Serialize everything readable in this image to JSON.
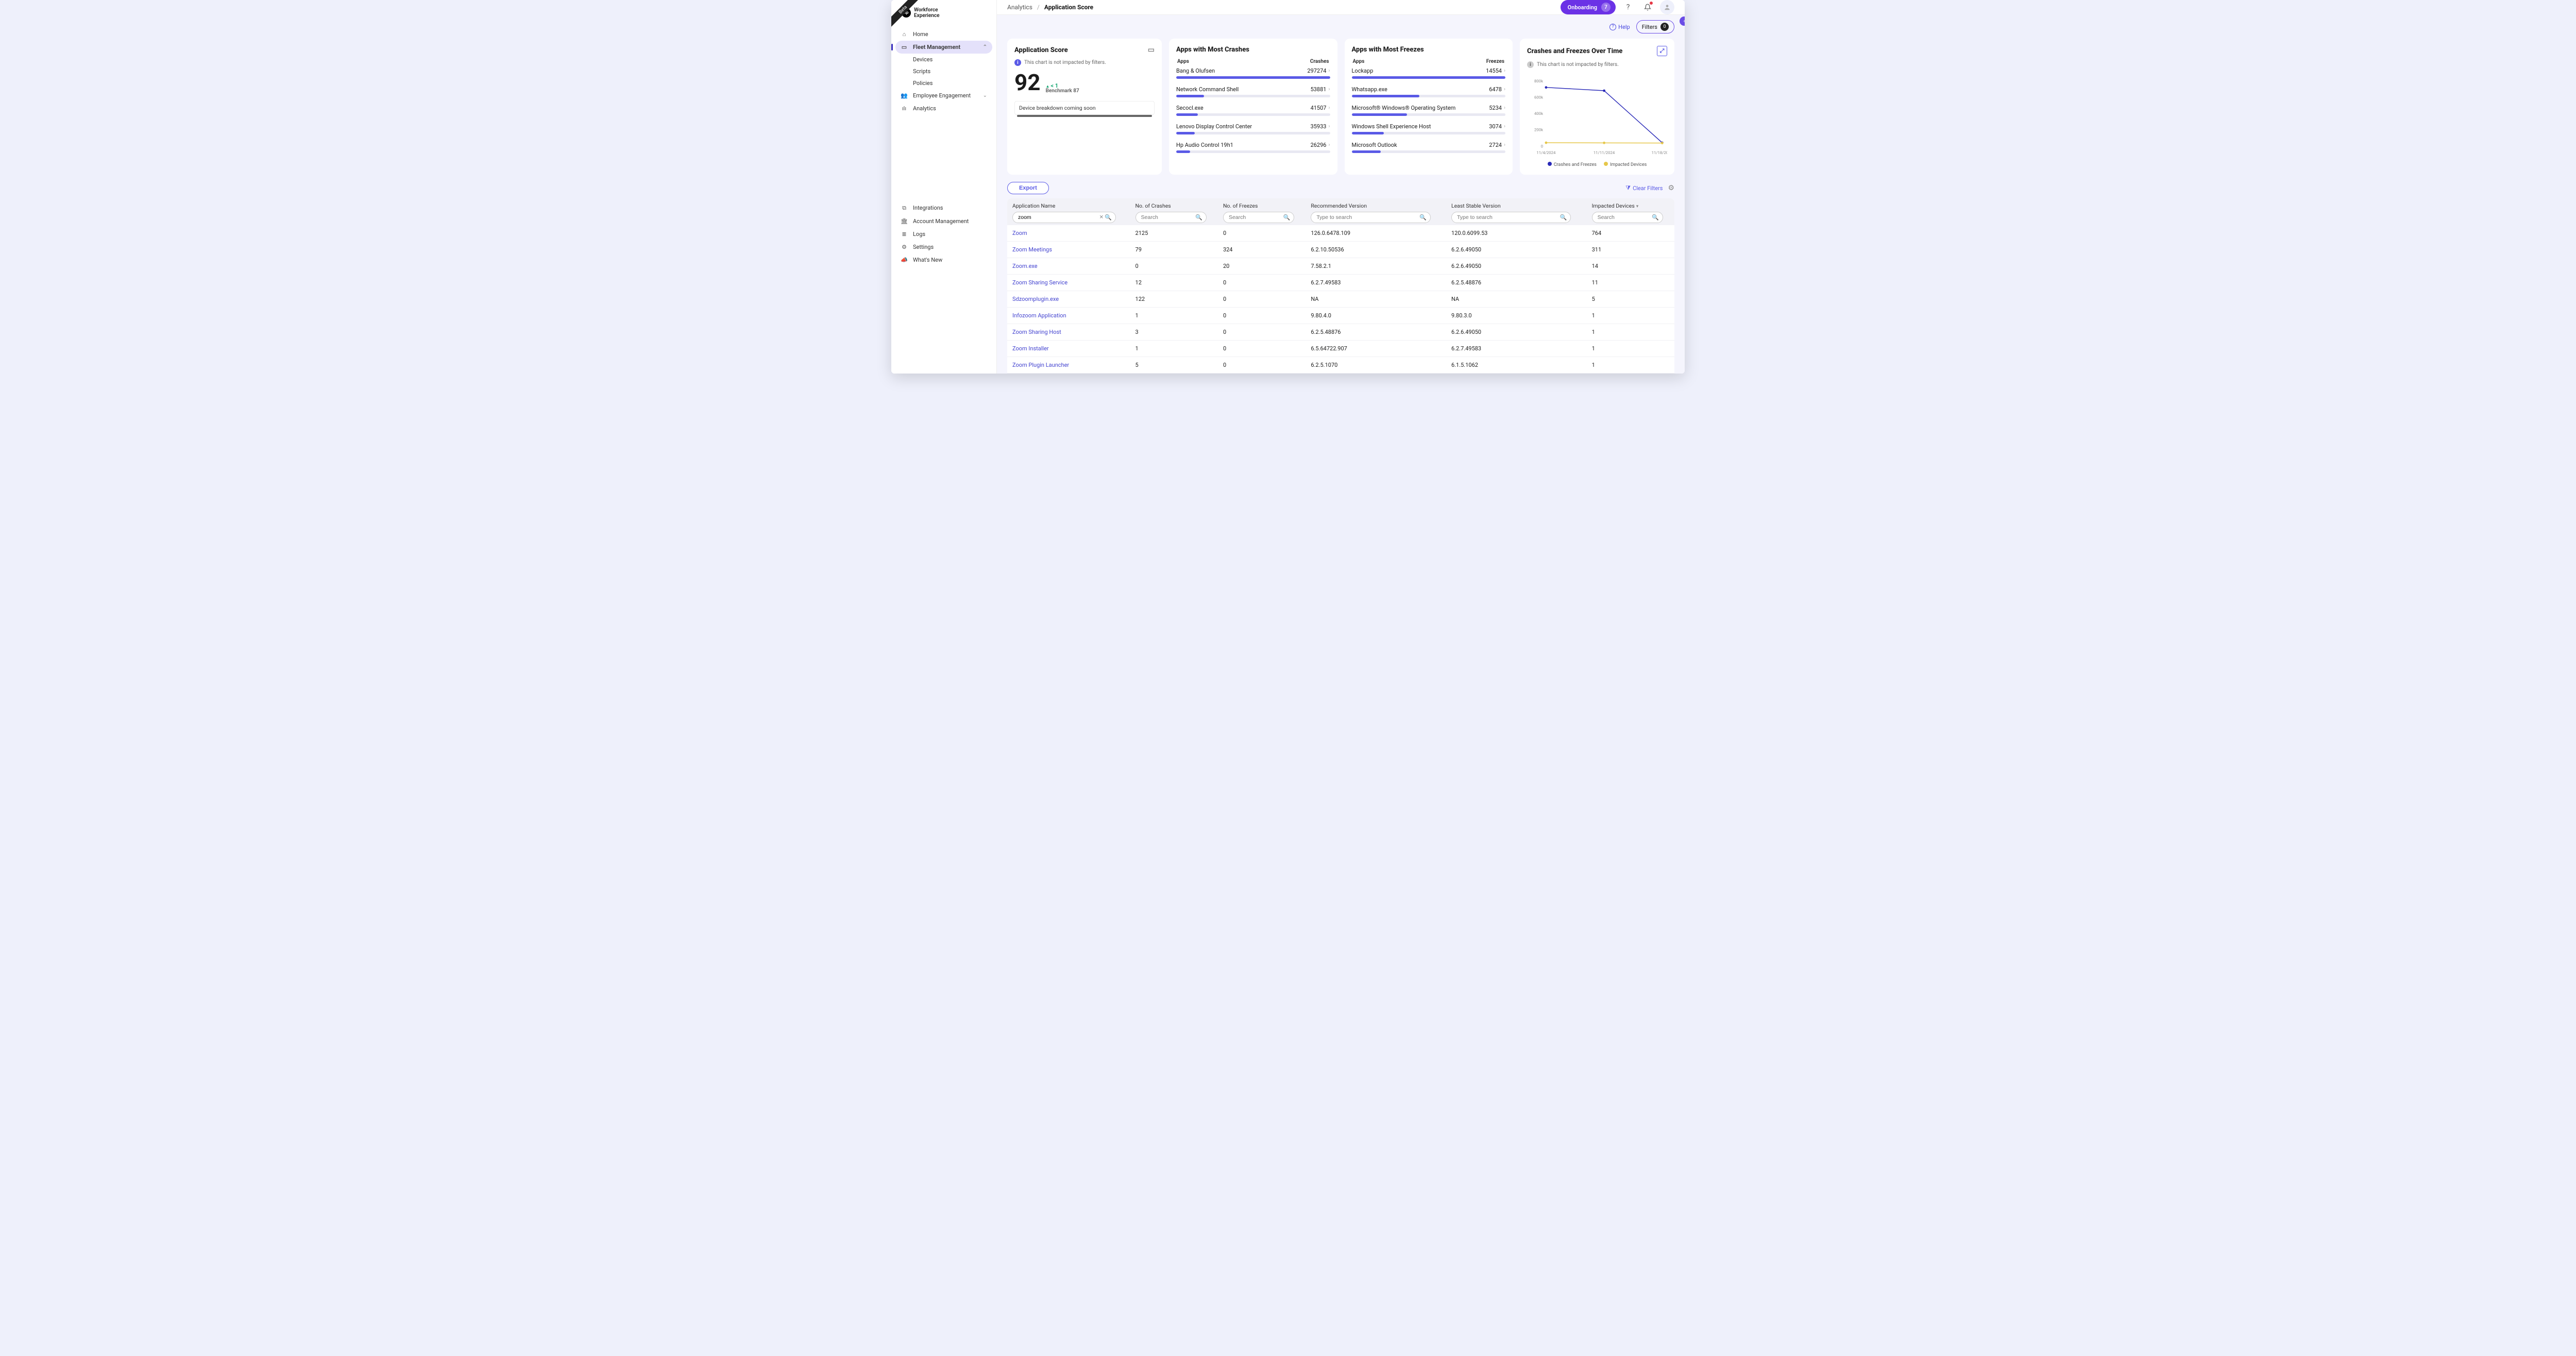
{
  "product": {
    "line1": "Workforce",
    "line2": "Experience",
    "beta": "Beta",
    "hp_glyph": "hp"
  },
  "sidebar": {
    "main": [
      {
        "label": "Home",
        "icon": "⌂"
      },
      {
        "label": "Fleet Management",
        "icon": "▭",
        "active": true,
        "expandable": true,
        "children": [
          "Devices",
          "Scripts",
          "Policies"
        ]
      },
      {
        "label": "Employee Engagement",
        "icon": "👥",
        "expandable": true
      },
      {
        "label": "Analytics",
        "icon": "ılı"
      }
    ],
    "bottom": [
      {
        "label": "Integrations",
        "icon": "⧉"
      },
      {
        "label": "Account Management",
        "icon": "🏛"
      },
      {
        "label": "Logs",
        "icon": "≣"
      },
      {
        "label": "Settings",
        "icon": "⚙"
      },
      {
        "label": "What's New",
        "icon": "📣"
      }
    ]
  },
  "breadcrumb": {
    "parent": "Analytics",
    "sep": "/",
    "current": "Application Score"
  },
  "topbar": {
    "onboarding_label": "Onboarding",
    "onboarding_count": "7"
  },
  "helprow": {
    "help_label": "Help",
    "filters_label": "Filters",
    "filters_count": "0"
  },
  "score_card": {
    "title": "Application Score",
    "note": "This chart is not impacted by filters.",
    "score": "92",
    "delta": "< 1",
    "benchmark_label": "Benchmark",
    "benchmark_value": "87",
    "breakdown_msg": "Device breakdown coming soon"
  },
  "crashes_card": {
    "title": "Apps with Most Crashes",
    "col_a": "Apps",
    "col_b": "Crashes",
    "rows": [
      {
        "name": "Bang & Olufsen",
        "value": "297274",
        "pct": 100
      },
      {
        "name": "Network Command Shell",
        "value": "53881",
        "pct": 18
      },
      {
        "name": "Secocl.exe",
        "value": "41507",
        "pct": 14
      },
      {
        "name": "Lenovo Display Control Center",
        "value": "35933",
        "pct": 12
      },
      {
        "name": "Hp Audio Control 19h1",
        "value": "26296",
        "pct": 9
      }
    ]
  },
  "freezes_card": {
    "title": "Apps with Most Freezes",
    "col_a": "Apps",
    "col_b": "Freezes",
    "rows": [
      {
        "name": "Lockapp",
        "value": "14554",
        "pct": 100
      },
      {
        "name": "Whatsapp.exe",
        "value": "6478",
        "pct": 44
      },
      {
        "name": "Microsoft® Windows® Operating System",
        "value": "5234",
        "pct": 36
      },
      {
        "name": "Windows Shell Experience Host",
        "value": "3074",
        "pct": 21
      },
      {
        "name": "Microsoft Outlook",
        "value": "2724",
        "pct": 19
      }
    ]
  },
  "chart_card": {
    "title": "Crashes and Freezes Over Time",
    "note": "This chart is not impacted by filters.",
    "legend_a": "Crashes and Freezes",
    "legend_b": "Impacted Devices"
  },
  "chart_data": {
    "type": "line",
    "x": [
      "11/4/2024",
      "11/11/2024",
      "11/18/2024"
    ],
    "ylabel": "",
    "ylim": [
      0,
      800000
    ],
    "yticks": [
      "0",
      "200k",
      "400k",
      "600k",
      "800k"
    ],
    "series": [
      {
        "name": "Crashes and Freezes",
        "color": "#2a2ab8",
        "values": [
          720000,
          680000,
          40000
        ]
      },
      {
        "name": "Impacted Devices",
        "color": "#e6c74a",
        "values": [
          40000,
          38000,
          36000
        ]
      }
    ]
  },
  "table_tools": {
    "export": "Export",
    "clear_filters": "Clear Filters"
  },
  "table": {
    "headers": [
      "Application Name",
      "No. of Crashes",
      "No. of Freezes",
      "Recommended Version",
      "Least Stable Version",
      "Impacted Devices"
    ],
    "sorted_col": 5,
    "search_placeholders": [
      "Search",
      "Search",
      "Search",
      "Type to search",
      "Type to search",
      "Search"
    ],
    "search_values": [
      "zoom",
      "",
      "",
      "",
      "",
      ""
    ],
    "rows": [
      [
        "Zoom",
        "2125",
        "0",
        "126.0.6478.109",
        "120.0.6099.53",
        "764"
      ],
      [
        "Zoom Meetings",
        "79",
        "324",
        "6.2.10.50536",
        "6.2.6.49050",
        "311"
      ],
      [
        "Zoom.exe",
        "0",
        "20",
        "7.58.2.1",
        "6.2.6.49050",
        "14"
      ],
      [
        "Zoom Sharing Service",
        "12",
        "0",
        "6.2.7.49583",
        "6.2.5.48876",
        "11"
      ],
      [
        "Sdzoomplugin.exe",
        "122",
        "0",
        "NA",
        "NA",
        "5"
      ],
      [
        "Infozoom Application",
        "1",
        "0",
        "9.80.4.0",
        "9.80.3.0",
        "1"
      ],
      [
        "Zoom Sharing Host",
        "3",
        "0",
        "6.2.5.48876",
        "6.2.6.49050",
        "1"
      ],
      [
        "Zoom Installer",
        "1",
        "0",
        "6.5.64722.907",
        "6.2.7.49583",
        "1"
      ],
      [
        "Zoom Plugin Launcher",
        "5",
        "0",
        "6.2.5.1070",
        "6.1.5.1062",
        "1"
      ]
    ]
  }
}
